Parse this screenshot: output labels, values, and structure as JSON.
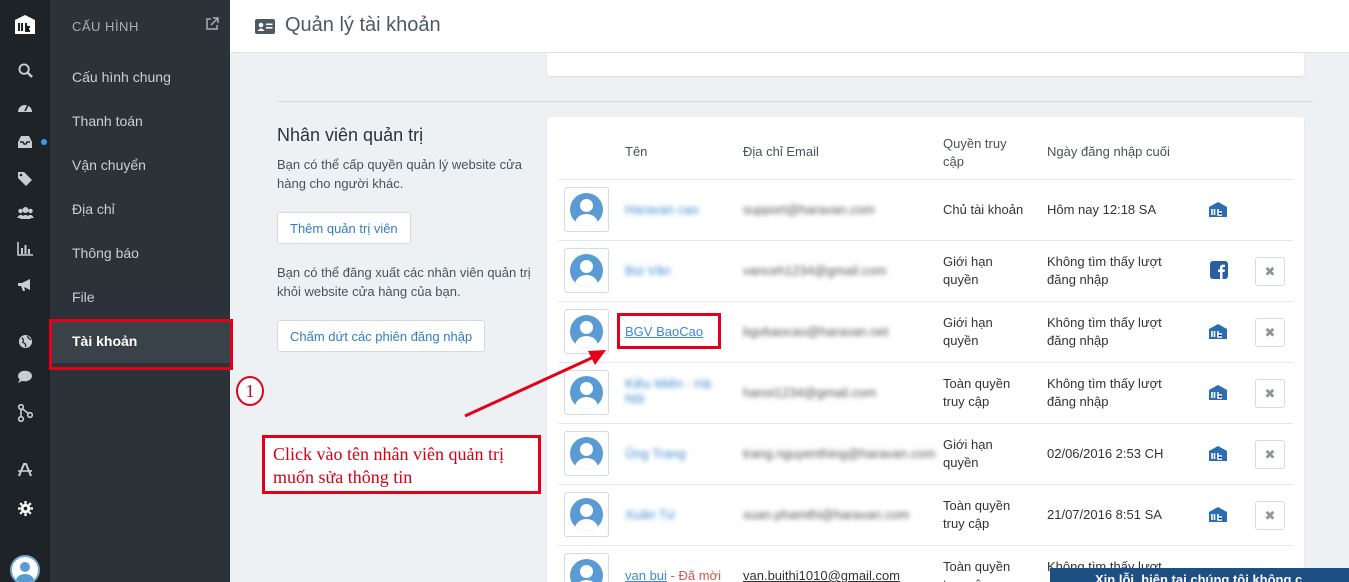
{
  "page": {
    "title": "Quản lý tài khoản"
  },
  "sidebar": {
    "heading": "CẤU HÌNH",
    "items": [
      {
        "label": "Cấu hình chung"
      },
      {
        "label": "Thanh toán"
      },
      {
        "label": "Vận chuyển"
      },
      {
        "label": "Địa chỉ"
      },
      {
        "label": "Thông báo"
      },
      {
        "label": "File"
      },
      {
        "label": "Tài khoản",
        "active": true
      }
    ]
  },
  "rail": {
    "icons": [
      "logo-icon",
      "search-icon",
      "dashboard-icon",
      "inbox-icon",
      "tags-icon",
      "users-icon",
      "stats-icon",
      "megaphone-icon",
      "globe-icon",
      "chat-icon",
      "share-icon",
      "apps-icon",
      "gear-icon",
      "avatar"
    ]
  },
  "admin_section": {
    "title": "Nhân viên quản trị",
    "description": "Bạn có thể cấp quyền quản lý website cửa hàng cho người khác.",
    "add_button": "Thêm quản trị viên",
    "logout_description": "Bạn có thể đăng xuất các nhân viên quản trị khỏi website cửa hàng của bạn.",
    "logout_button": "Chấm dứt các phiên đăng nhập"
  },
  "table": {
    "headers": {
      "name": "Tên",
      "email": "Địa chỉ Email",
      "access": "Quyền truy cập",
      "last_login": "Ngày đăng nhập cuối"
    },
    "rows": [
      {
        "name": "Haravan cao",
        "email": "support@haravan.com",
        "access": "Chủ tài khoản",
        "last_login": "Hôm nay 12:18 SA",
        "source": "logo",
        "deletable": false,
        "blurred": true
      },
      {
        "name": "Bùi Vân",
        "email": "vanceh1234@gmail.com",
        "access": "Giới hạn quyền",
        "last_login": "Không tìm thấy lượt đăng nhập",
        "source": "facebook",
        "deletable": true,
        "blurred": true
      },
      {
        "name": "BGV BaoCao",
        "email": "bgvbaocao@haravan.net",
        "access": "Giới hạn quyền",
        "last_login": "Không tìm thấy lượt đăng nhập",
        "source": "logo",
        "deletable": true,
        "blurred": false
      },
      {
        "name": "Kiều Miên - Hà Nội",
        "email": "hanoi1234@gmail.com",
        "access": "Toàn quyền truy cập",
        "last_login": "Không tìm thấy lượt đăng nhập",
        "source": "logo",
        "deletable": true,
        "blurred": true
      },
      {
        "name": "Ủng Trang",
        "email": "trang.nguyenthing@haravan.com",
        "access": "Giới hạn quyền",
        "last_login": "02/06/2016 2:53 CH",
        "source": "logo",
        "deletable": true,
        "blurred": true
      },
      {
        "name": "Xuân Tứ",
        "email": "xuan.phamthi@haravan.com",
        "access": "Toàn quyền truy cập",
        "last_login": "21/07/2016 8:51 SA",
        "source": "logo",
        "deletable": true,
        "blurred": true
      },
      {
        "name": "van bui",
        "name_suffix": "- Đã mời",
        "email": "van.buithi1010@gmail.com",
        "access": "Toàn quyền truy cập",
        "last_login": "Không tìm thấy lượt đăng nhập",
        "source": "logo",
        "deletable": true,
        "blurred": false
      }
    ]
  },
  "annotation": {
    "step_number": "1",
    "instruction": "Click vào tên nhân viên quản trị muốn sửa thông tin"
  },
  "bottom_bar": {
    "text": "Xin lỗi, hiện tại chúng tôi không c..."
  },
  "colors": {
    "accent": "#3d8ad0",
    "highlight": "#e4001b",
    "sidebar": "#2c3338",
    "rail": "#1e2327"
  }
}
